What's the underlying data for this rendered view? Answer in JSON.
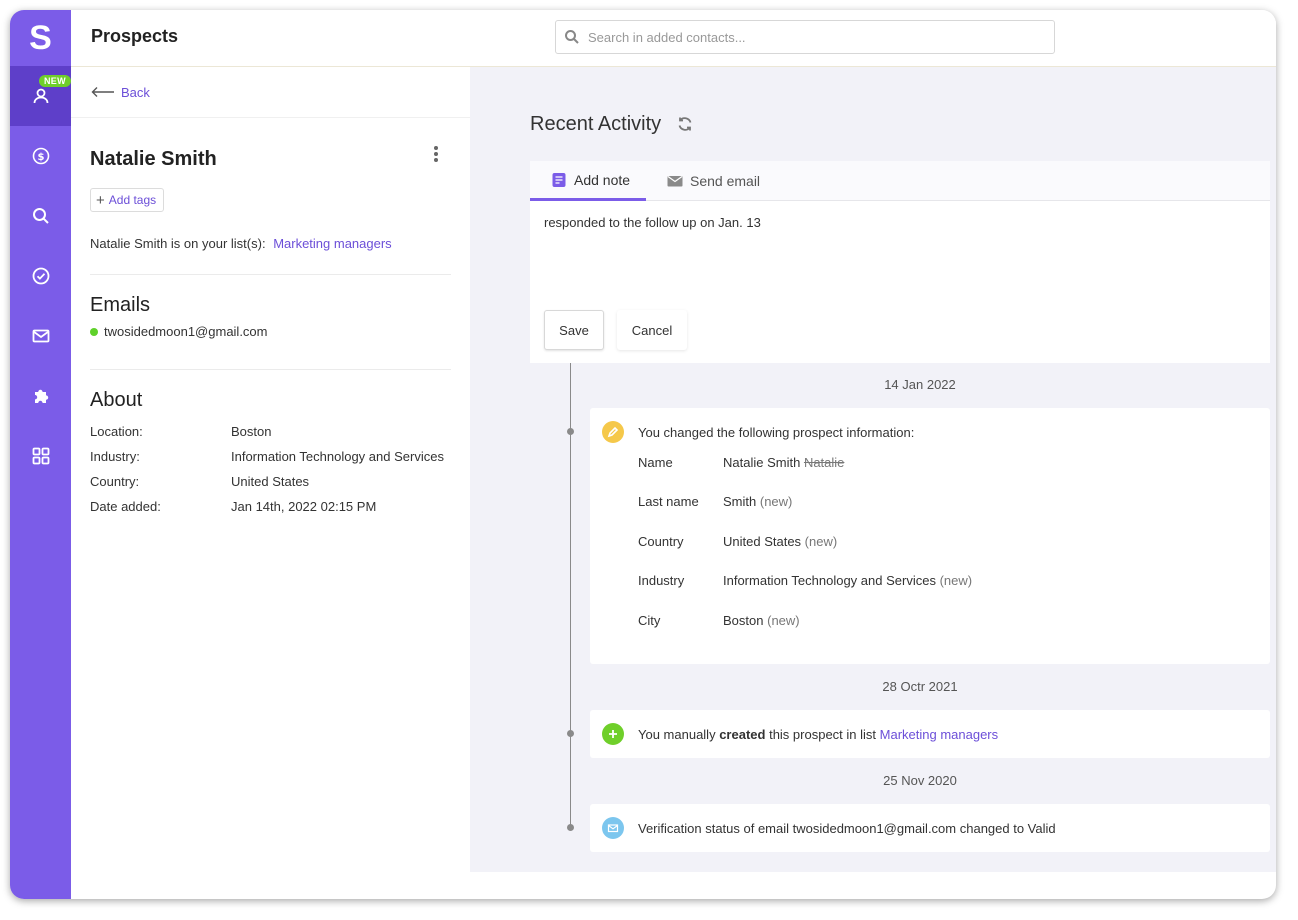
{
  "app": {
    "logo_letter": "S",
    "new_badge": "NEW"
  },
  "header": {
    "title": "Prospects",
    "search_placeholder": "Search in added contacts..."
  },
  "sidebar": {
    "items": [
      {
        "icon": "user-icon",
        "active": true
      },
      {
        "icon": "dollar-icon"
      },
      {
        "icon": "search-icon"
      },
      {
        "icon": "check-circle-icon"
      },
      {
        "icon": "mail-icon"
      },
      {
        "icon": "puzzle-icon"
      },
      {
        "icon": "apps-grid-icon"
      }
    ]
  },
  "contact": {
    "back_label": "Back",
    "name": "Natalie Smith",
    "add_tags_label": "Add tags",
    "list_prefix": "Natalie Smith is on your list(s):",
    "list_name": "Marketing managers",
    "emails_title": "Emails",
    "email": "twosidedmoon1@gmail.com",
    "email_status_color": "#5fd12a",
    "about_title": "About",
    "about": [
      {
        "label": "Location:",
        "value": "Boston"
      },
      {
        "label": "Industry:",
        "value": "Information Technology and Services"
      },
      {
        "label": "Country:",
        "value": "United States"
      },
      {
        "label": "Date added:",
        "value": "Jan 14th, 2022 02:15 PM"
      }
    ]
  },
  "activity": {
    "title": "Recent Activity",
    "tabs": [
      {
        "label": "Add note",
        "active": true
      },
      {
        "label": "Send email"
      }
    ],
    "note_text": "responded to the follow up on Jan. 13",
    "save_label": "Save",
    "cancel_label": "Cancel",
    "events": [
      {
        "date": "14 Jan 2022",
        "text": "You changed the following prospect information:",
        "icon_color": "#f5c84a",
        "changes": [
          {
            "field": "Name",
            "value": "Natalie Smith",
            "old": "Natalie"
          },
          {
            "field": "Last name",
            "value": "Smith",
            "note": "(new)"
          },
          {
            "field": "Country",
            "value": "United States",
            "note": "(new)"
          },
          {
            "field": "Industry",
            "value": "Information Technology and Services",
            "note": "(new)"
          },
          {
            "field": "City",
            "value": "Boston",
            "note": "(new)"
          }
        ]
      },
      {
        "date": "28 Octr 2021",
        "text_prefix": "You manually",
        "text_bold": "created",
        "text_mid": "this prospect in list",
        "text_link": "Marketing managers",
        "icon_color": "#6fcf2a"
      },
      {
        "date": "25 Nov 2020",
        "text": "Verification status of email twosidedmoon1@gmail.com changed to Valid",
        "icon_color": "#7cc6ee"
      }
    ]
  },
  "colors": {
    "brand": "#7b5ce8",
    "brand_dark": "#5e3fc9",
    "link": "#6c4fd8"
  }
}
